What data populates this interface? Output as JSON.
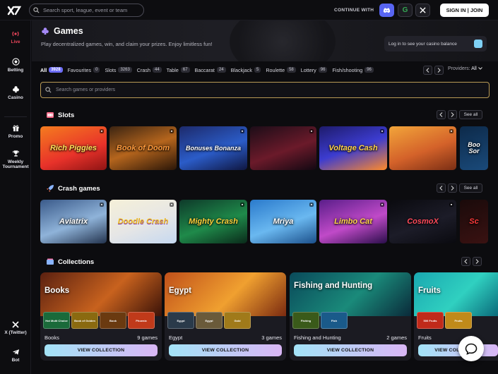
{
  "header": {
    "search_placeholder": "Search sport, league, event or team",
    "continue_with": "CONTINUE WITH",
    "signin_label": "SIGN IN | JOIN",
    "social_icons": [
      "discord-icon",
      "google-icon",
      "x-icon"
    ]
  },
  "sidebar": {
    "items": [
      {
        "label": "Live",
        "icon": "broadcast-icon",
        "active": true
      },
      {
        "label": "Betting",
        "icon": "soccer-ball-icon"
      },
      {
        "label": "Casino",
        "icon": "club-suit-icon"
      },
      {
        "label": "Promo",
        "icon": "gift-icon"
      },
      {
        "label": "Weekly Tournament",
        "icon": "trophy-icon"
      },
      {
        "label": "X (Twitter)",
        "icon": "x-icon"
      },
      {
        "label": "Bot",
        "icon": "telegram-icon"
      }
    ]
  },
  "page": {
    "title": "Games",
    "subtitle": "Play decentralized games, win, and claim your prizes. Enjoy limitless fun!",
    "balance_prompt": "Log in to see your casino balance"
  },
  "filters": {
    "tabs": [
      {
        "label": "All",
        "count": "3928",
        "active": true
      },
      {
        "label": "Favourites",
        "count": "0"
      },
      {
        "label": "Slots",
        "count": "3263"
      },
      {
        "label": "Crash",
        "count": "44"
      },
      {
        "label": "Table",
        "count": "67"
      },
      {
        "label": "Baccarat",
        "count": "24"
      },
      {
        "label": "Blackjack",
        "count": "5"
      },
      {
        "label": "Roulette",
        "count": "58"
      },
      {
        "label": "Lottery",
        "count": "96"
      },
      {
        "label": "Fish/shooting",
        "count": "96"
      }
    ],
    "providers_label": "Providers:",
    "providers_value": "All"
  },
  "game_search": {
    "placeholder": "Search games or providers"
  },
  "sections": {
    "slots": {
      "title": "Slots",
      "see_all": "See all",
      "games": [
        "Rich Piggies",
        "Book of Doom",
        "Bonuses Bonanza",
        "",
        "Voltage Cash",
        "",
        "Boo Sor"
      ]
    },
    "crash": {
      "title": "Crash games",
      "see_all": "See all",
      "games": [
        "Aviatrix",
        "Doodle Crash",
        "Mighty Crash",
        "Mriya",
        "Limbo Cat",
        "CosmoX",
        "Sc"
      ]
    },
    "collections": {
      "title": "Collections",
      "cards": [
        {
          "name": "Books",
          "label": "Books",
          "count": "9 games",
          "button": "VIEW COLLECTION",
          "thumbs": [
            "Hot Multi Choice",
            "Book of Golden",
            "Book",
            "Phoenix"
          ]
        },
        {
          "name": "Egypt",
          "label": "Egypt",
          "count": "3 games",
          "button": "VIEW COLLECTION",
          "thumbs": [
            "Egypt",
            "Egypt",
            "Gold"
          ]
        },
        {
          "name": "Fishing and Hunting",
          "label": "Fishing and Hunting",
          "count": "2 games",
          "button": "VIEW COLLECTION",
          "thumbs": [
            "Fishing",
            "Fish"
          ]
        },
        {
          "name": "Fruits",
          "label": "Fruits",
          "count": "",
          "button": "VIEW COLLECTION",
          "thumbs": [
            "500 Fruits",
            "Fruits"
          ]
        }
      ]
    }
  }
}
